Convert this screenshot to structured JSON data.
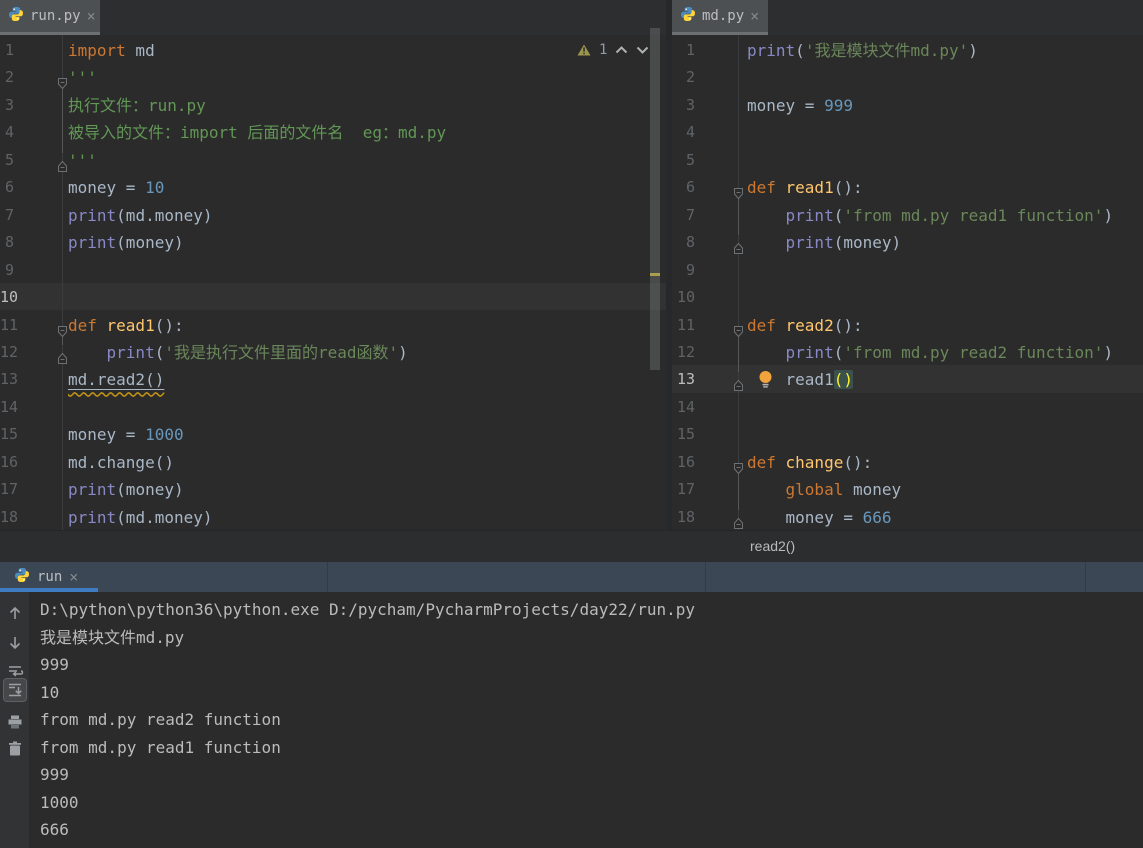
{
  "colors": {
    "editor_bg": "#2B2B2B",
    "caret_row": "#323232",
    "keyword": "#CC7832",
    "function_name": "#FFC66D",
    "builtin": "#8888C6",
    "string": "#6A8759",
    "number": "#6897BB",
    "plain": "#A9B7C6",
    "tab_accent": "#3E7BC0",
    "warning_stripe": "#A8A04C",
    "console_header_bg": "#3B4754"
  },
  "tabs": {
    "left_editor": "run.py",
    "right_editor": "md.py",
    "console": "run",
    "close_glyph": "×"
  },
  "inspection": {
    "warning_count": "1"
  },
  "breadcrumb": {
    "label": "read2()"
  },
  "editors": {
    "left": {
      "caret_line": 10,
      "fold_guides": [
        [
          2,
          5
        ],
        [
          11,
          12
        ]
      ],
      "lines": [
        {
          "n": 1,
          "seg": [
            [
              "kw",
              "import"
            ],
            [
              "pl",
              " md"
            ]
          ]
        },
        {
          "n": 2,
          "fold": "start",
          "seg": [
            [
              "doc",
              "'''"
            ]
          ]
        },
        {
          "n": 3,
          "seg": [
            [
              "doc",
              "执行文件：run.py"
            ]
          ]
        },
        {
          "n": 4,
          "seg": [
            [
              "doc",
              "被导入的文件：import 后面的文件名  eg：md.py"
            ]
          ]
        },
        {
          "n": 5,
          "fold": "end",
          "seg": [
            [
              "doc",
              "'''"
            ]
          ]
        },
        {
          "n": 6,
          "seg": [
            [
              "pl",
              "money = "
            ],
            [
              "num",
              "10"
            ]
          ]
        },
        {
          "n": 7,
          "seg": [
            [
              "bi",
              "print"
            ],
            [
              "pl",
              "(md.money)"
            ]
          ]
        },
        {
          "n": 8,
          "seg": [
            [
              "bi",
              "print"
            ],
            [
              "pl",
              "(money)"
            ]
          ]
        },
        {
          "n": 9,
          "seg": []
        },
        {
          "n": 10,
          "seg": []
        },
        {
          "n": 11,
          "fold": "start",
          "seg": [
            [
              "kw",
              "def "
            ],
            [
              "fn",
              "read1"
            ],
            [
              "pl",
              "():"
            ]
          ]
        },
        {
          "n": 12,
          "fold": "end",
          "seg": [
            [
              "pl",
              "    "
            ],
            [
              "bi",
              "print"
            ],
            [
              "pl",
              "("
            ],
            [
              "str",
              "'我是执行文件里面的read函数'"
            ],
            [
              "pl",
              ")"
            ]
          ]
        },
        {
          "n": 13,
          "seg": [
            [
              "wl",
              "md.read2()"
            ]
          ]
        },
        {
          "n": 14,
          "seg": []
        },
        {
          "n": 15,
          "seg": [
            [
              "pl",
              "money = "
            ],
            [
              "num",
              "1000"
            ]
          ]
        },
        {
          "n": 16,
          "seg": [
            [
              "pl",
              "md.change()"
            ]
          ]
        },
        {
          "n": 17,
          "seg": [
            [
              "bi",
              "print"
            ],
            [
              "pl",
              "(money)"
            ]
          ]
        },
        {
          "n": 18,
          "seg": [
            [
              "bi",
              "print"
            ],
            [
              "pl",
              "(md.money)"
            ]
          ]
        }
      ]
    },
    "right": {
      "caret_line": 13,
      "fold_guides": [
        [
          6,
          8
        ],
        [
          11,
          13
        ],
        [
          16,
          18
        ]
      ],
      "lines": [
        {
          "n": 1,
          "seg": [
            [
              "bi",
              "print"
            ],
            [
              "pl",
              "("
            ],
            [
              "str",
              "'我是模块文件md.py'"
            ],
            [
              "pl",
              ")"
            ]
          ]
        },
        {
          "n": 2,
          "seg": []
        },
        {
          "n": 3,
          "seg": [
            [
              "pl",
              "money = "
            ],
            [
              "num",
              "999"
            ]
          ]
        },
        {
          "n": 4,
          "seg": []
        },
        {
          "n": 5,
          "seg": []
        },
        {
          "n": 6,
          "fold": "start",
          "seg": [
            [
              "kw",
              "def "
            ],
            [
              "fn",
              "read1"
            ],
            [
              "pl",
              "():"
            ]
          ]
        },
        {
          "n": 7,
          "seg": [
            [
              "pl",
              "    "
            ],
            [
              "bi",
              "print"
            ],
            [
              "pl",
              "("
            ],
            [
              "str",
              "'from md.py read1 function'"
            ],
            [
              "pl",
              ")"
            ]
          ]
        },
        {
          "n": 8,
          "fold": "end",
          "seg": [
            [
              "pl",
              "    "
            ],
            [
              "bi",
              "print"
            ],
            [
              "pl",
              "(money)"
            ]
          ]
        },
        {
          "n": 9,
          "seg": []
        },
        {
          "n": 10,
          "seg": []
        },
        {
          "n": 11,
          "fold": "start",
          "seg": [
            [
              "kw",
              "def "
            ],
            [
              "fn",
              "read2"
            ],
            [
              "pl",
              "():"
            ]
          ]
        },
        {
          "n": 12,
          "seg": [
            [
              "pl",
              "    "
            ],
            [
              "bi",
              "print"
            ],
            [
              "pl",
              "("
            ],
            [
              "str",
              "'from md.py read2 function'"
            ],
            [
              "pl",
              ")"
            ]
          ]
        },
        {
          "n": 13,
          "fold": "end",
          "bulb": true,
          "seg": [
            [
              "pl",
              "    read1"
            ],
            [
              "mt",
              "()"
            ]
          ]
        },
        {
          "n": 14,
          "seg": []
        },
        {
          "n": 15,
          "seg": []
        },
        {
          "n": 16,
          "fold": "start",
          "seg": [
            [
              "kw",
              "def "
            ],
            [
              "fn",
              "change"
            ],
            [
              "pl",
              "():"
            ]
          ]
        },
        {
          "n": 17,
          "seg": [
            [
              "pl",
              "    "
            ],
            [
              "kw",
              "global"
            ],
            [
              "pl",
              " money"
            ]
          ]
        },
        {
          "n": 18,
          "fold": "end",
          "seg": [
            [
              "pl",
              "    money = "
            ],
            [
              "num",
              "666"
            ]
          ]
        }
      ]
    }
  },
  "console": {
    "tab_label": "run",
    "toolbar_icons": [
      "up-arrow-icon",
      "down-arrow-icon",
      "soft-wrap-icon",
      "scroll-to-end-icon",
      "print-icon",
      "clear-all-icon"
    ],
    "selected_toolbar_icon": "scroll-to-end-icon",
    "output": [
      "D:\\python\\python36\\python.exe D:/pycham/PycharmProjects/day22/run.py",
      "我是模块文件md.py",
      "999",
      "10",
      "from md.py read2 function",
      "from md.py read1 function",
      "999",
      "1000",
      "666"
    ]
  }
}
